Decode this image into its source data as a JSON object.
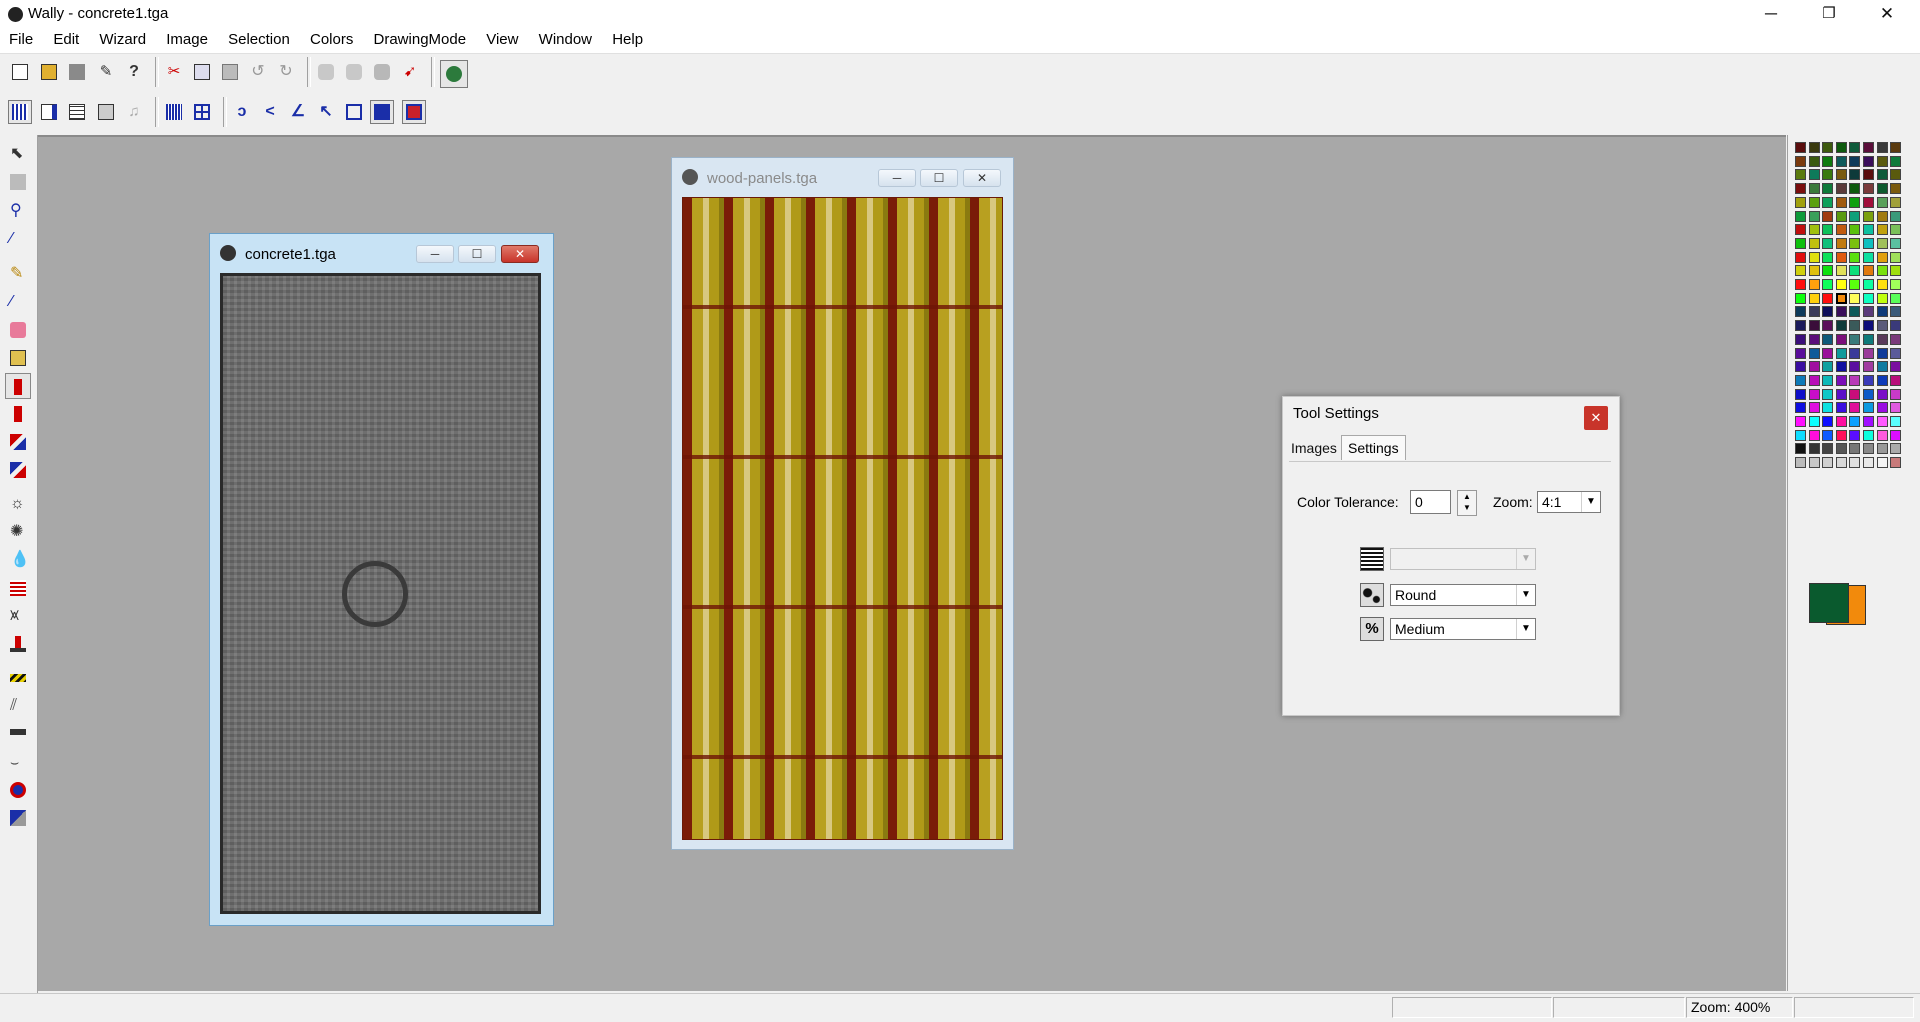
{
  "app": {
    "window_title": "Wally - concrete1.tga",
    "minimize_glyph": "─",
    "maximize_glyph": "❐",
    "close_glyph": "✕"
  },
  "menu": [
    "File",
    "Edit",
    "Wizard",
    "Image",
    "Selection",
    "Colors",
    "DrawingMode",
    "View",
    "Window",
    "Help"
  ],
  "toolbar1_icons": [
    "new-icon",
    "open-icon",
    "save-icon",
    "wizard-icon",
    "help-icon",
    "cut-icon",
    "copy-icon",
    "paste-icon",
    "undo-icon",
    "redo-icon",
    "filter1-icon",
    "filter2-icon",
    "filter3-icon",
    "pointer-red-icon",
    "render-icon"
  ],
  "toolbar2_icons": [
    "grid-fine-icon",
    "panel-icon",
    "grid-icon",
    "view-icon",
    "music-icon",
    "tile-icon",
    "tile-grid-icon",
    "spiral-icon",
    "arrow-left-icon",
    "arrow-shape-icon",
    "arrow-corner-icon",
    "layers-icon",
    "fill-navy-icon",
    "fill-red-icon"
  ],
  "tools": [
    "select-icon",
    "ruler-icon",
    "zoom-icon",
    "eyedropper-icon",
    "pencil-icon",
    "brush-icon",
    "eraser-icon",
    "fill-bucket-icon",
    "spray-icon",
    "spray-can-icon",
    "clone-icon",
    "clone-red-icon",
    "sun-icon",
    "sun-small-icon",
    "drop-icon",
    "stripes-icon",
    "mesh-icon",
    "stamp-icon",
    "hazard-icon",
    "hatch-icon",
    "gun-icon",
    "cup-icon",
    "badge-icon",
    "pixel-icon"
  ],
  "windows": {
    "concrete": {
      "title": "concrete1.tga",
      "min": "─",
      "max": "☐",
      "close": "✕"
    },
    "wood": {
      "title": "wood-panels.tga",
      "min": "─",
      "max": "☐",
      "close": "✕"
    }
  },
  "tool_settings": {
    "title": "Tool Settings",
    "close": "✕",
    "tabs": [
      "Images",
      "Settings"
    ],
    "active_tab": "Settings",
    "color_tolerance_label": "Color Tolerance:",
    "color_tolerance_value": "0",
    "zoom_label": "Zoom:",
    "zoom_value": "4:1",
    "row1_value": "",
    "shape_value": "Round",
    "size_value": "Medium"
  },
  "colors": {
    "primary": "#0a5a2e",
    "secondary": "#f28a0c",
    "workspace": "#a8a8a8",
    "close_red": "#c8342a"
  },
  "status": {
    "panel1": "",
    "panel2": "",
    "zoom_text": "Zoom: 400%",
    "panel4": ""
  }
}
